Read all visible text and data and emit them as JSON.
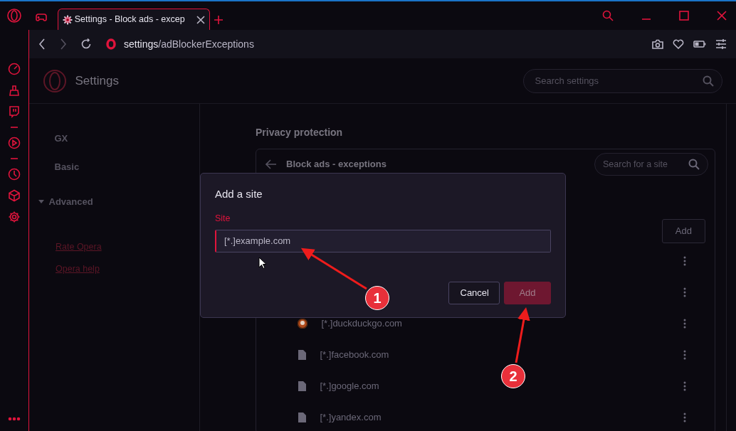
{
  "tab": {
    "title": "Settings - Block ads - excep"
  },
  "address_bar": {
    "host": "settings",
    "path": "/adBlockerExceptions"
  },
  "header": {
    "title": "Settings",
    "search_placeholder": "Search settings"
  },
  "nav": {
    "items": [
      {
        "label": "GX",
        "kind": "item"
      },
      {
        "label": "Basic",
        "kind": "item"
      },
      {
        "label": "Advanced",
        "kind": "group",
        "expanded": true
      }
    ],
    "links": [
      "Rate Opera",
      "Opera help"
    ]
  },
  "section_title": "Privacy protection",
  "exceptions": {
    "title": "Block ads - exceptions",
    "search_placeholder": "Search for a site",
    "add_button": "Add",
    "sites": [
      {
        "kind": "covered"
      },
      {
        "kind": "covered"
      },
      {
        "kind": "favicon",
        "name": "[*.]duckduckgo.com"
      },
      {
        "kind": "file",
        "name": "[*.]facebook.com"
      },
      {
        "kind": "file",
        "name": "[*.]google.com"
      },
      {
        "kind": "file",
        "name": "[*.]yandex.com"
      }
    ]
  },
  "dialog": {
    "title": "Add a site",
    "field_label": "Site",
    "placeholder": "[*.]example.com",
    "buttons": [
      {
        "label": "Cancel",
        "kind": "secondary",
        "disabled": false
      },
      {
        "label": "Add",
        "kind": "primary",
        "disabled": true
      }
    ]
  },
  "annotations": [
    {
      "label": "1"
    },
    {
      "label": "2"
    }
  ]
}
